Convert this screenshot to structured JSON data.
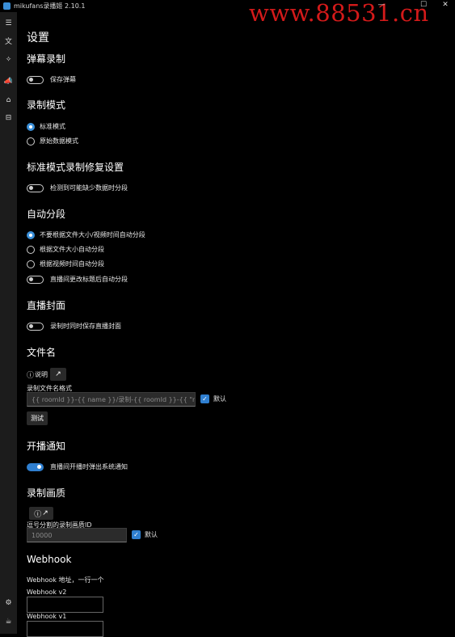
{
  "window": {
    "title": "mikufans录播姬 2.10.1",
    "watermark": "www.88531.cn",
    "minimize": "—",
    "maximize": "☐",
    "close": "✕"
  },
  "rail": {
    "icons": [
      "menu-icon",
      "translate-icon",
      "magic-icon",
      "announce-icon",
      "home-icon",
      "inbox-icon",
      "settings-icon",
      "coffee-icon"
    ],
    "glyphs": [
      "☰",
      "文",
      "✧",
      "📣",
      "⌂",
      "⊟",
      "⚙",
      "☕"
    ]
  },
  "page": {
    "title": "设置"
  },
  "danmaku": {
    "heading": "弹幕录制",
    "save_label": "保存弹幕",
    "save_on": false
  },
  "record_mode": {
    "heading": "录制模式",
    "options": [
      "标准模式",
      "原始数据模式"
    ],
    "selected": 0
  },
  "fix": {
    "heading": "标准模式录制修复设置",
    "split_label": "检测到可能缺少数据时分段",
    "split_on": false
  },
  "auto_split": {
    "heading": "自动分段",
    "options": [
      "不要根据文件大小/视频时间自动分段",
      "根据文件大小自动分段",
      "根据视频时间自动分段"
    ],
    "selected": 0,
    "title_change_label": "直播间更改标题后自动分段",
    "title_change_on": false
  },
  "cover": {
    "heading": "直播封面",
    "save_label": "录制时同时保存直播封面",
    "save_on": false
  },
  "filename": {
    "heading": "文件名",
    "info_icon": "ⓘ",
    "info_label": "说明",
    "open_icon": "↗",
    "format_label": "录制文件名格式",
    "format_value": "{{ roomId }}-{{ name }}/录制-{{ roomId }}-{{ \"now\" | time_zone: \"Asia/Shanghai\" | format_date: \"yyyyMMdd-HHmmss-fff\" }}-{{ title }}.flv",
    "default_label": "默认",
    "test_button": "测试"
  },
  "notify": {
    "heading": "开播通知",
    "label": "直播间开播时弹出系统通知",
    "on": true
  },
  "quality": {
    "heading": "录制画质",
    "info_icon": "ⓘ",
    "open_icon": "↗",
    "label": "逗号分割的录制画质ID",
    "placeholder": "10000",
    "default_label": "默认"
  },
  "webhook": {
    "heading": "Webhook",
    "description": "Webhook 地址，一行一个",
    "v2_label": "Webhook v2",
    "v1_label": "Webhook v1"
  }
}
